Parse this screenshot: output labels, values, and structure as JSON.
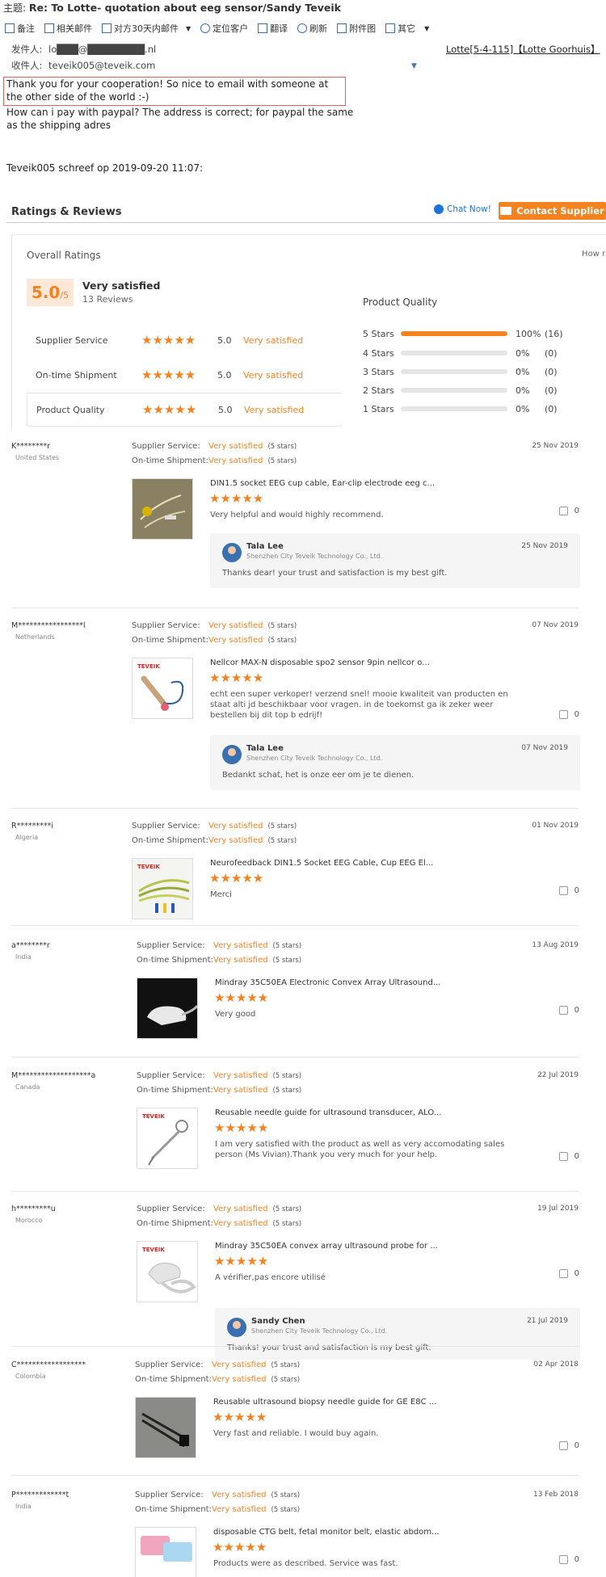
{
  "email": {
    "subject_label": "主题:",
    "subject": "Re: To Lotte- quotation about eeg sensor/Sandy Teveik",
    "toolbar": [
      {
        "label": "备注",
        "icon": "note-icon"
      },
      {
        "label": "相关邮件",
        "icon": "related-mail-icon"
      },
      {
        "label": "对方30天内邮件",
        "icon": "mail-history-icon"
      },
      {
        "label": "定位客户",
        "icon": "locate-customer-icon"
      },
      {
        "label": "翻译",
        "icon": "translate-icon"
      },
      {
        "label": "刷新",
        "icon": "refresh-icon"
      },
      {
        "label": "附件图",
        "icon": "attachment-image-icon"
      },
      {
        "label": "其它",
        "icon": "more-icon"
      }
    ],
    "from_label": "发件人:",
    "from_value": "lo███@████████.nl",
    "to_label": "收件人:",
    "to_value": "teveik005@teveik.com",
    "contact_link": "Lotte[5-4-115]【Lotte Goorhuis】",
    "body_highlight": "Thank you for your cooperation! So nice to email with someone at the other side of the world :-)",
    "body_rest": "How can i pay with paypal? The address is correct; for paypal the same as the shipping adres",
    "quote_line": "Teveik005 schreef op 2019-09-20 11:07:"
  },
  "ratings": {
    "title": "Ratings & Reviews",
    "chat_label": "Chat Now!",
    "contact_label": "Contact Supplier",
    "overall_title": "Overall Ratings",
    "how_rated": "How ra",
    "score": "5.0",
    "score_max": "/5",
    "overall_text": "Very satisfied",
    "review_count": "13 Reviews",
    "accent_color": "#f5821f",
    "criteria": [
      {
        "label": "Supplier Service",
        "score": "5.0",
        "text": "Very satisfied"
      },
      {
        "label": "On-time Shipment",
        "score": "5.0",
        "text": "Very satisfied"
      },
      {
        "label": "Product Quality",
        "score": "5.0",
        "text": "Very satisfied"
      }
    ],
    "product_quality_title": "Product Quality",
    "distribution": [
      {
        "label": "5 Stars",
        "pct": "100%",
        "count": "(16)",
        "fraction": 1.0
      },
      {
        "label": "4 Stars",
        "pct": "0%",
        "count": "(0)",
        "fraction": 0
      },
      {
        "label": "3 Stars",
        "pct": "0%",
        "count": "(0)",
        "fraction": 0
      },
      {
        "label": "2 Stars",
        "pct": "0%",
        "count": "(0)",
        "fraction": 0
      },
      {
        "label": "1 Stars",
        "pct": "0%",
        "count": "(0)",
        "fraction": 0
      }
    ]
  },
  "reviews": [
    {
      "name": "K********r",
      "country": "United States",
      "date": "25 Nov 2019",
      "service_label": "Supplier Service:",
      "service": "Very satisfied",
      "service_stars": "(5 stars)",
      "shipment_label": "On-time Shipment:",
      "shipment": "Very satisfied",
      "shipment_stars": "(5 stars)",
      "product": "DIN1.5 socket EEG cup cable, Ear-clip electrode eeg c...",
      "text": "Very helpful and would highly recommend.",
      "likes": "0",
      "reply": {
        "name": "Tala Lee",
        "company": "Shenzhen City Teveik Technology Co., Ltd.",
        "date": "25 Nov 2019",
        "text": "Thanks dear! your trust and satisfaction is my best gift."
      }
    },
    {
      "name": "M*****************l",
      "country": "Netherlands",
      "date": "07 Nov 2019",
      "service_label": "Supplier Service:",
      "service": "Very satisfied",
      "service_stars": "(5 stars)",
      "shipment_label": "On-time Shipment:",
      "shipment": "Very satisfied",
      "shipment_stars": "(5 stars)",
      "product": "Nellcor MAX-N disposable spo2 sensor 9pin nellcor o...",
      "text": "echt een super verkoper! verzend snel! mooie kwaliteit van producten en staat alti jd beschikbaar voor vragen. in de toekomst ga ik zeker weer bestellen bij dit top b edrijf!",
      "likes": "0",
      "reply": {
        "name": "Tala Lee",
        "company": "Shenzhen City Teveik Technology Co., Ltd.",
        "date": "07 Nov 2019",
        "text": "Bedankt schat, het is onze eer om je te dienen."
      }
    },
    {
      "name": "R*********i",
      "country": "Algeria",
      "date": "01 Nov 2019",
      "service_label": "Supplier Service:",
      "service": "Very satisfied",
      "service_stars": "(5 stars)",
      "shipment_label": "On-time Shipment:",
      "shipment": "Very satisfied",
      "shipment_stars": "(5 stars)",
      "product": "Neurofeedback DIN1.5 Socket EEG Cable, Cup EEG El...",
      "text": "Merci",
      "likes": "0"
    },
    {
      "name": "a********r",
      "country": "India",
      "date": "13 Aug 2019",
      "service_label": "Supplier Service:",
      "service": "Very satisfied",
      "service_stars": "(5 stars)",
      "shipment_label": "On-time Shipment:",
      "shipment": "Very satisfied",
      "shipment_stars": "(5 stars)",
      "product": "Mindray 35C50EA Electronic Convex Array Ultrasound...",
      "text": "Very good",
      "likes": "0"
    },
    {
      "name": "M*******************a",
      "country": "Canada",
      "date": "22 Jul 2019",
      "service_label": "Supplier Service:",
      "service": "Very satisfied",
      "service_stars": "(5 stars)",
      "shipment_label": "On-time Shipment:",
      "shipment": "Very satisfied",
      "shipment_stars": "(5 stars)",
      "product": "Reusable needle guide for ultrasound transducer, ALO...",
      "text": "I am very satisfied with the product as well as very accomodating sales person (Ms Vivian).Thank you very much for your help.",
      "likes": "0"
    },
    {
      "name": "h*********u",
      "country": "Morocco",
      "date": "19 Jul 2019",
      "service_label": "Supplier Service:",
      "service": "Very satisfied",
      "service_stars": "(5 stars)",
      "shipment_label": "On-time Shipment:",
      "shipment": "Very satisfied",
      "shipment_stars": "(5 stars)",
      "product": "Mindray 35C50EA convex array ultrasound probe for ...",
      "text": "A vérifier,pas encore utilisé",
      "likes": "0",
      "reply": {
        "name": "Sandy Chen",
        "company": "Shenzhen City Teveik Technology Co., Ltd.",
        "date": "21 Jul 2019",
        "text": "Thanks! your trust and satisfaction is my best gift."
      }
    },
    {
      "name": "C******************",
      "country": "Colombia",
      "date": "02 Apr 2018",
      "service_label": "Supplier Service:",
      "service": "Very satisfied",
      "service_stars": "(5 stars)",
      "shipment_label": "On-time Shipment:",
      "shipment": "Very satisfied",
      "shipment_stars": "(5 stars)",
      "product": "Reusable ultrasound biopsy needle guide for GE E8C ...",
      "text": "Very fast and reliable. I would buy again.",
      "likes": "0"
    },
    {
      "name": "P*************t",
      "country": "India",
      "date": "13 Feb 2018",
      "service_label": "Supplier Service:",
      "service": "Very satisfied",
      "service_stars": "(5 stars)",
      "shipment_label": "On-time Shipment:",
      "shipment": "Very satisfied",
      "shipment_stars": "(5 stars)",
      "product": "disposable CTG belt, fetal monitor belt, elastic abdom...",
      "text": "Products were as described. Service was fast.",
      "likes": "0"
    }
  ],
  "product_quality_stars": 5,
  "thumb_brand": "TEVEIK"
}
